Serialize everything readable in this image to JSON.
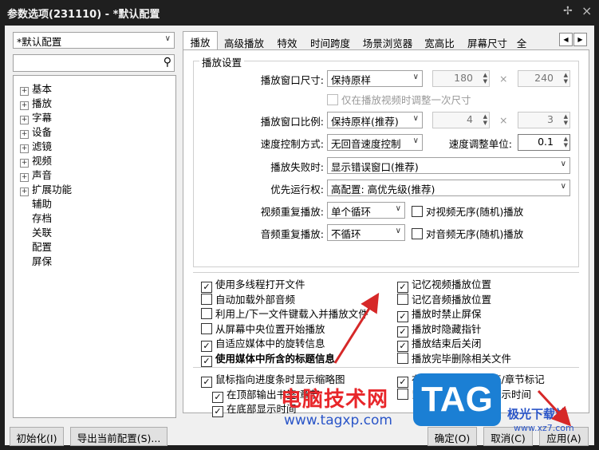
{
  "window": {
    "title": "参数选项(231110) - *默认配置"
  },
  "profile_select": {
    "value": "*默认配置"
  },
  "tree": {
    "items": [
      {
        "label": "基本",
        "expandable": true
      },
      {
        "label": "播放",
        "expandable": true
      },
      {
        "label": "字幕",
        "expandable": true
      },
      {
        "label": "设备",
        "expandable": true
      },
      {
        "label": "滤镜",
        "expandable": true
      },
      {
        "label": "视频",
        "expandable": true
      },
      {
        "label": "声音",
        "expandable": true
      },
      {
        "label": "扩展功能",
        "expandable": true
      },
      {
        "label": "辅助",
        "expandable": false
      },
      {
        "label": "存档",
        "expandable": false
      },
      {
        "label": "关联",
        "expandable": false
      },
      {
        "label": "配置",
        "expandable": false
      },
      {
        "label": "屏保",
        "expandable": false
      }
    ]
  },
  "tabs": [
    "播放",
    "高级播放",
    "特效",
    "时间跨度",
    "场景浏览器",
    "宽高比",
    "屏幕尺寸",
    "全"
  ],
  "group": {
    "title": "播放设置",
    "window_size_label": "播放窗口尺寸:",
    "window_size_value": "保持原样",
    "width_value": "180",
    "height_value": "240",
    "times": "×",
    "resize_once_label": "仅在播放视频时调整一次尺寸",
    "ratio_label": "播放窗口比例:",
    "ratio_value": "保持原样(推荐)",
    "ratio_w": "4",
    "ratio_h": "3",
    "speed_mode_label": "速度控制方式:",
    "speed_mode_value": "无回音速度控制",
    "speed_unit_label": "速度调整单位:",
    "speed_unit_value": "0.1",
    "fail_label": "播放失败时:",
    "fail_value": "显示错误窗口(推荐)",
    "priority_label": "优先运行权:",
    "priority_value": "高配置: 高优先级(推荐)",
    "video_repeat_label": "视频重复播放:",
    "video_repeat_value": "单个循环",
    "video_shuffle_label": "对视频无序(随机)播放",
    "audio_repeat_label": "音频重复播放:",
    "audio_repeat_value": "不循环",
    "audio_shuffle_label": "对音频无序(随机)播放"
  },
  "options_left": [
    {
      "label": "使用多线程打开文件",
      "checked": true
    },
    {
      "label": "自动加载外部音频",
      "checked": false
    },
    {
      "label": "利用上/下一文件键载入并播放文件",
      "checked": false
    },
    {
      "label": "从屏幕中央位置开始播放",
      "checked": false
    },
    {
      "label": "自适应媒体中的旋转信息",
      "checked": true
    },
    {
      "label": "使用媒体中所含的标题信息",
      "checked": true
    }
  ],
  "options_right": [
    {
      "label": "记忆视频播放位置",
      "checked": true
    },
    {
      "label": "记忆音频播放位置",
      "checked": false
    },
    {
      "label": "播放时禁止屏保",
      "checked": true
    },
    {
      "label": "播放时隐藏指针",
      "checked": true
    },
    {
      "label": "播放结束后关闭",
      "checked": true
    },
    {
      "label": "播放完毕删除相关文件",
      "checked": false
    }
  ],
  "progress_left": [
    {
      "label": "鼠标指向进度条时显示缩略图",
      "checked": true
    },
    {
      "label": "在顶部输出书签/章节",
      "checked": true
    },
    {
      "label": "在底部显示时间",
      "checked": true
    }
  ],
  "progress_right": [
    {
      "label": "在进度条上显示书签/章节标记",
      "checked": true
    },
    {
      "label": "鼠标在进度条上时显示时间",
      "checked": false
    }
  ],
  "buttons": {
    "init": "初始化(I)",
    "export": "导出当前配置(S)...",
    "ok": "确定(O)",
    "cancel": "取消(C)",
    "apply": "应用(A)"
  },
  "watermark": {
    "site_cn": "电脑技术网",
    "site_url": "www.tagxp.com",
    "logo_text": "TAG",
    "brand": "极光下载站",
    "brand_url": "www.xz7.com"
  },
  "colors": {
    "annotation_arrow": "#d62828",
    "watermark_red": "#e8262a",
    "logo_blue": "#1b7fd4"
  }
}
